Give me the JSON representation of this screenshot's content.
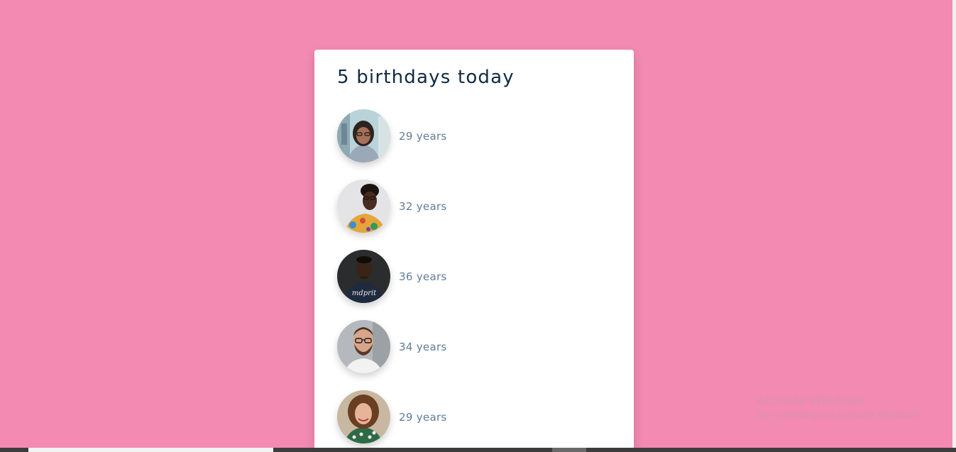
{
  "header": {
    "title": "5 birthdays today"
  },
  "people": [
    {
      "age_label": "29 years",
      "avatar_icon": "person-avatar-woman-glasses"
    },
    {
      "age_label": "32 years",
      "avatar_icon": "person-avatar-woman-floral"
    },
    {
      "age_label": "36 years",
      "avatar_icon": "person-avatar-man-dark-shirt"
    },
    {
      "age_label": "34 years",
      "avatar_icon": "person-avatar-man-glasses-beard"
    },
    {
      "age_label": "29 years",
      "avatar_icon": "person-avatar-woman-curly-hair"
    }
  ],
  "watermark": {
    "title": "Activate Windows",
    "subtitle": "Go to Settings to activate Windows."
  },
  "colors": {
    "background": "#f28ab2",
    "card": "#ffffff",
    "title_text": "#102a42",
    "age_text": "#617d98"
  }
}
